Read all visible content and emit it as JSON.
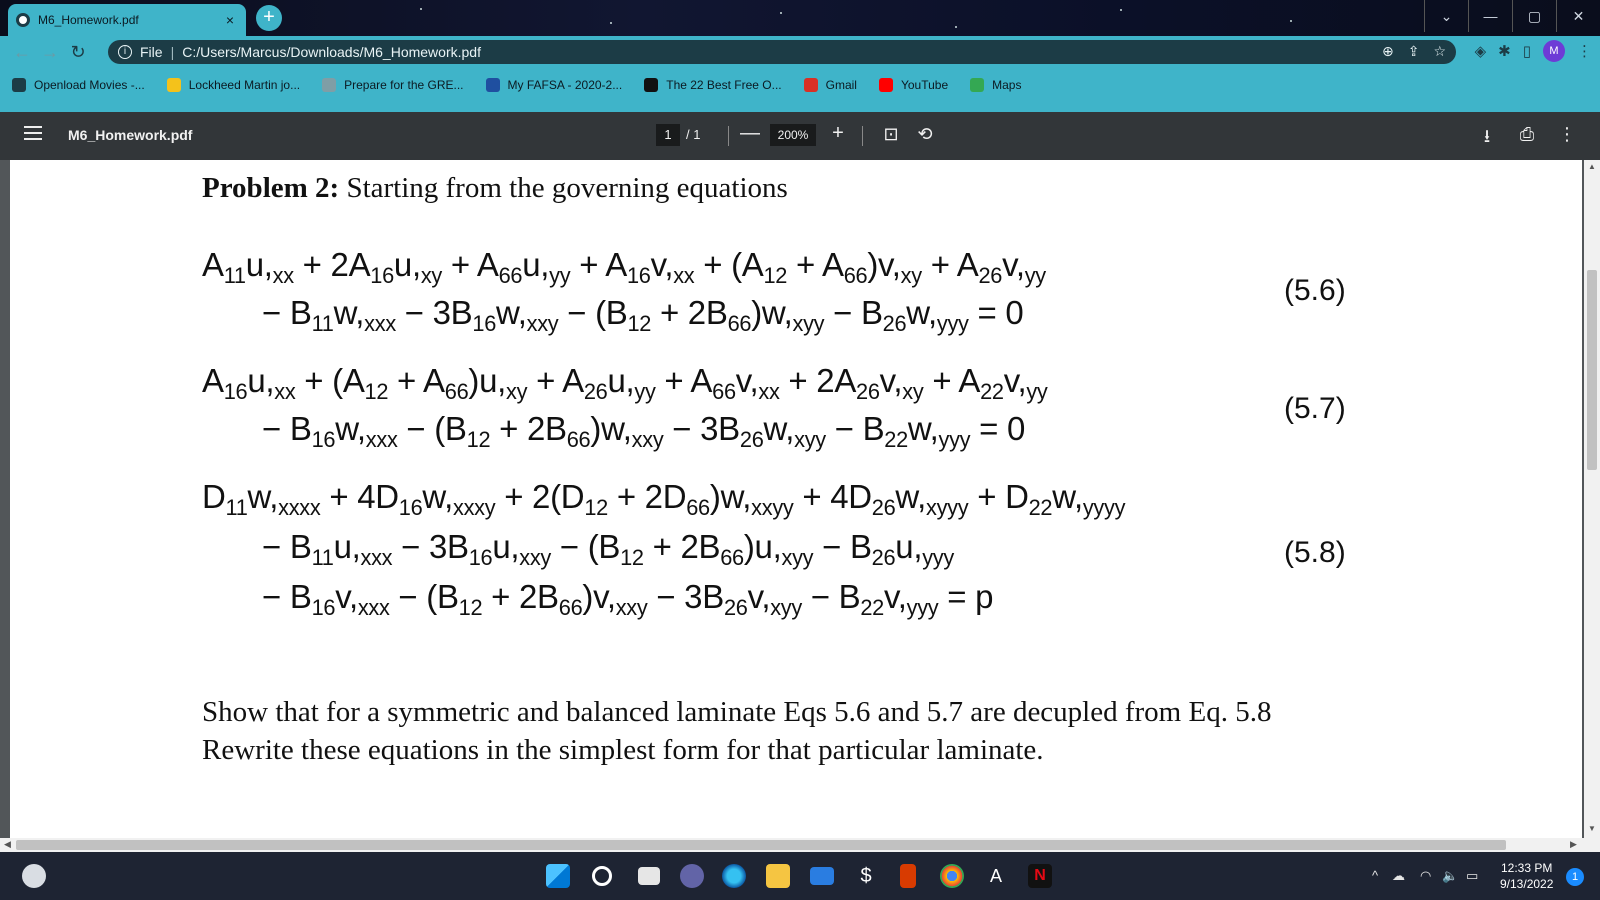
{
  "browser": {
    "tab": {
      "title": "M6_Homework.pdf",
      "close": "×"
    },
    "new_tab": "+",
    "window_controls": {
      "list": "⌄",
      "minimize": "—",
      "restore": "▢",
      "close": "✕"
    },
    "address": {
      "scheme_label": "File",
      "url": "C:/Users/Marcus/Downloads/M6_Homework.pdf"
    },
    "profile_initial": "M",
    "bookmarks": [
      {
        "label": "Openload Movies -...",
        "icon": "infinity-icon",
        "color": "#1c3c46"
      },
      {
        "label": "Lockheed Martin jo...",
        "icon": "sun-icon",
        "color": "#f4c21b"
      },
      {
        "label": "Prepare for the GRE...",
        "icon": "globe-icon",
        "color": "#7f9ea6"
      },
      {
        "label": "My FAFSA - 2020-2...",
        "icon": "fafsa-icon",
        "color": "#1f4fa0"
      },
      {
        "label": "The 22 Best Free O...",
        "icon": "t-icon",
        "color": "#111111"
      },
      {
        "label": "Gmail",
        "icon": "gmail-icon",
        "color": "#d93025"
      },
      {
        "label": "YouTube",
        "icon": "youtube-icon",
        "color": "#ff0000"
      },
      {
        "label": "Maps",
        "icon": "maps-icon",
        "color": "#34a853"
      }
    ]
  },
  "pdf_viewer": {
    "title": "M6_Homework.pdf",
    "page_current": "1",
    "page_total": "/ 1",
    "zoom_out": "—",
    "zoom": "200%",
    "zoom_in": "+"
  },
  "document": {
    "problem_label": "Problem 2:",
    "problem_text": " Starting from the governing equations",
    "eq56_num": "(5.6)",
    "eq57_num": "(5.7)",
    "eq58_num": "(5.8)",
    "prose_line1": "Show that for a symmetric and balanced laminate Eqs 5.6 and 5.7 are decupled from Eq. 5.8",
    "prose_line2": "Rewrite these equations in the simplest form for that particular laminate."
  },
  "taskbar": {
    "time": "12:33 PM",
    "date": "9/13/2022",
    "notification_count": "1"
  },
  "colors": {
    "chrome_accent": "#3fb4c9",
    "omnibox": "#1c3c46",
    "pdf_toolbar": "#323639",
    "viewer_bg": "#525659",
    "taskbar": "#1e2433"
  }
}
